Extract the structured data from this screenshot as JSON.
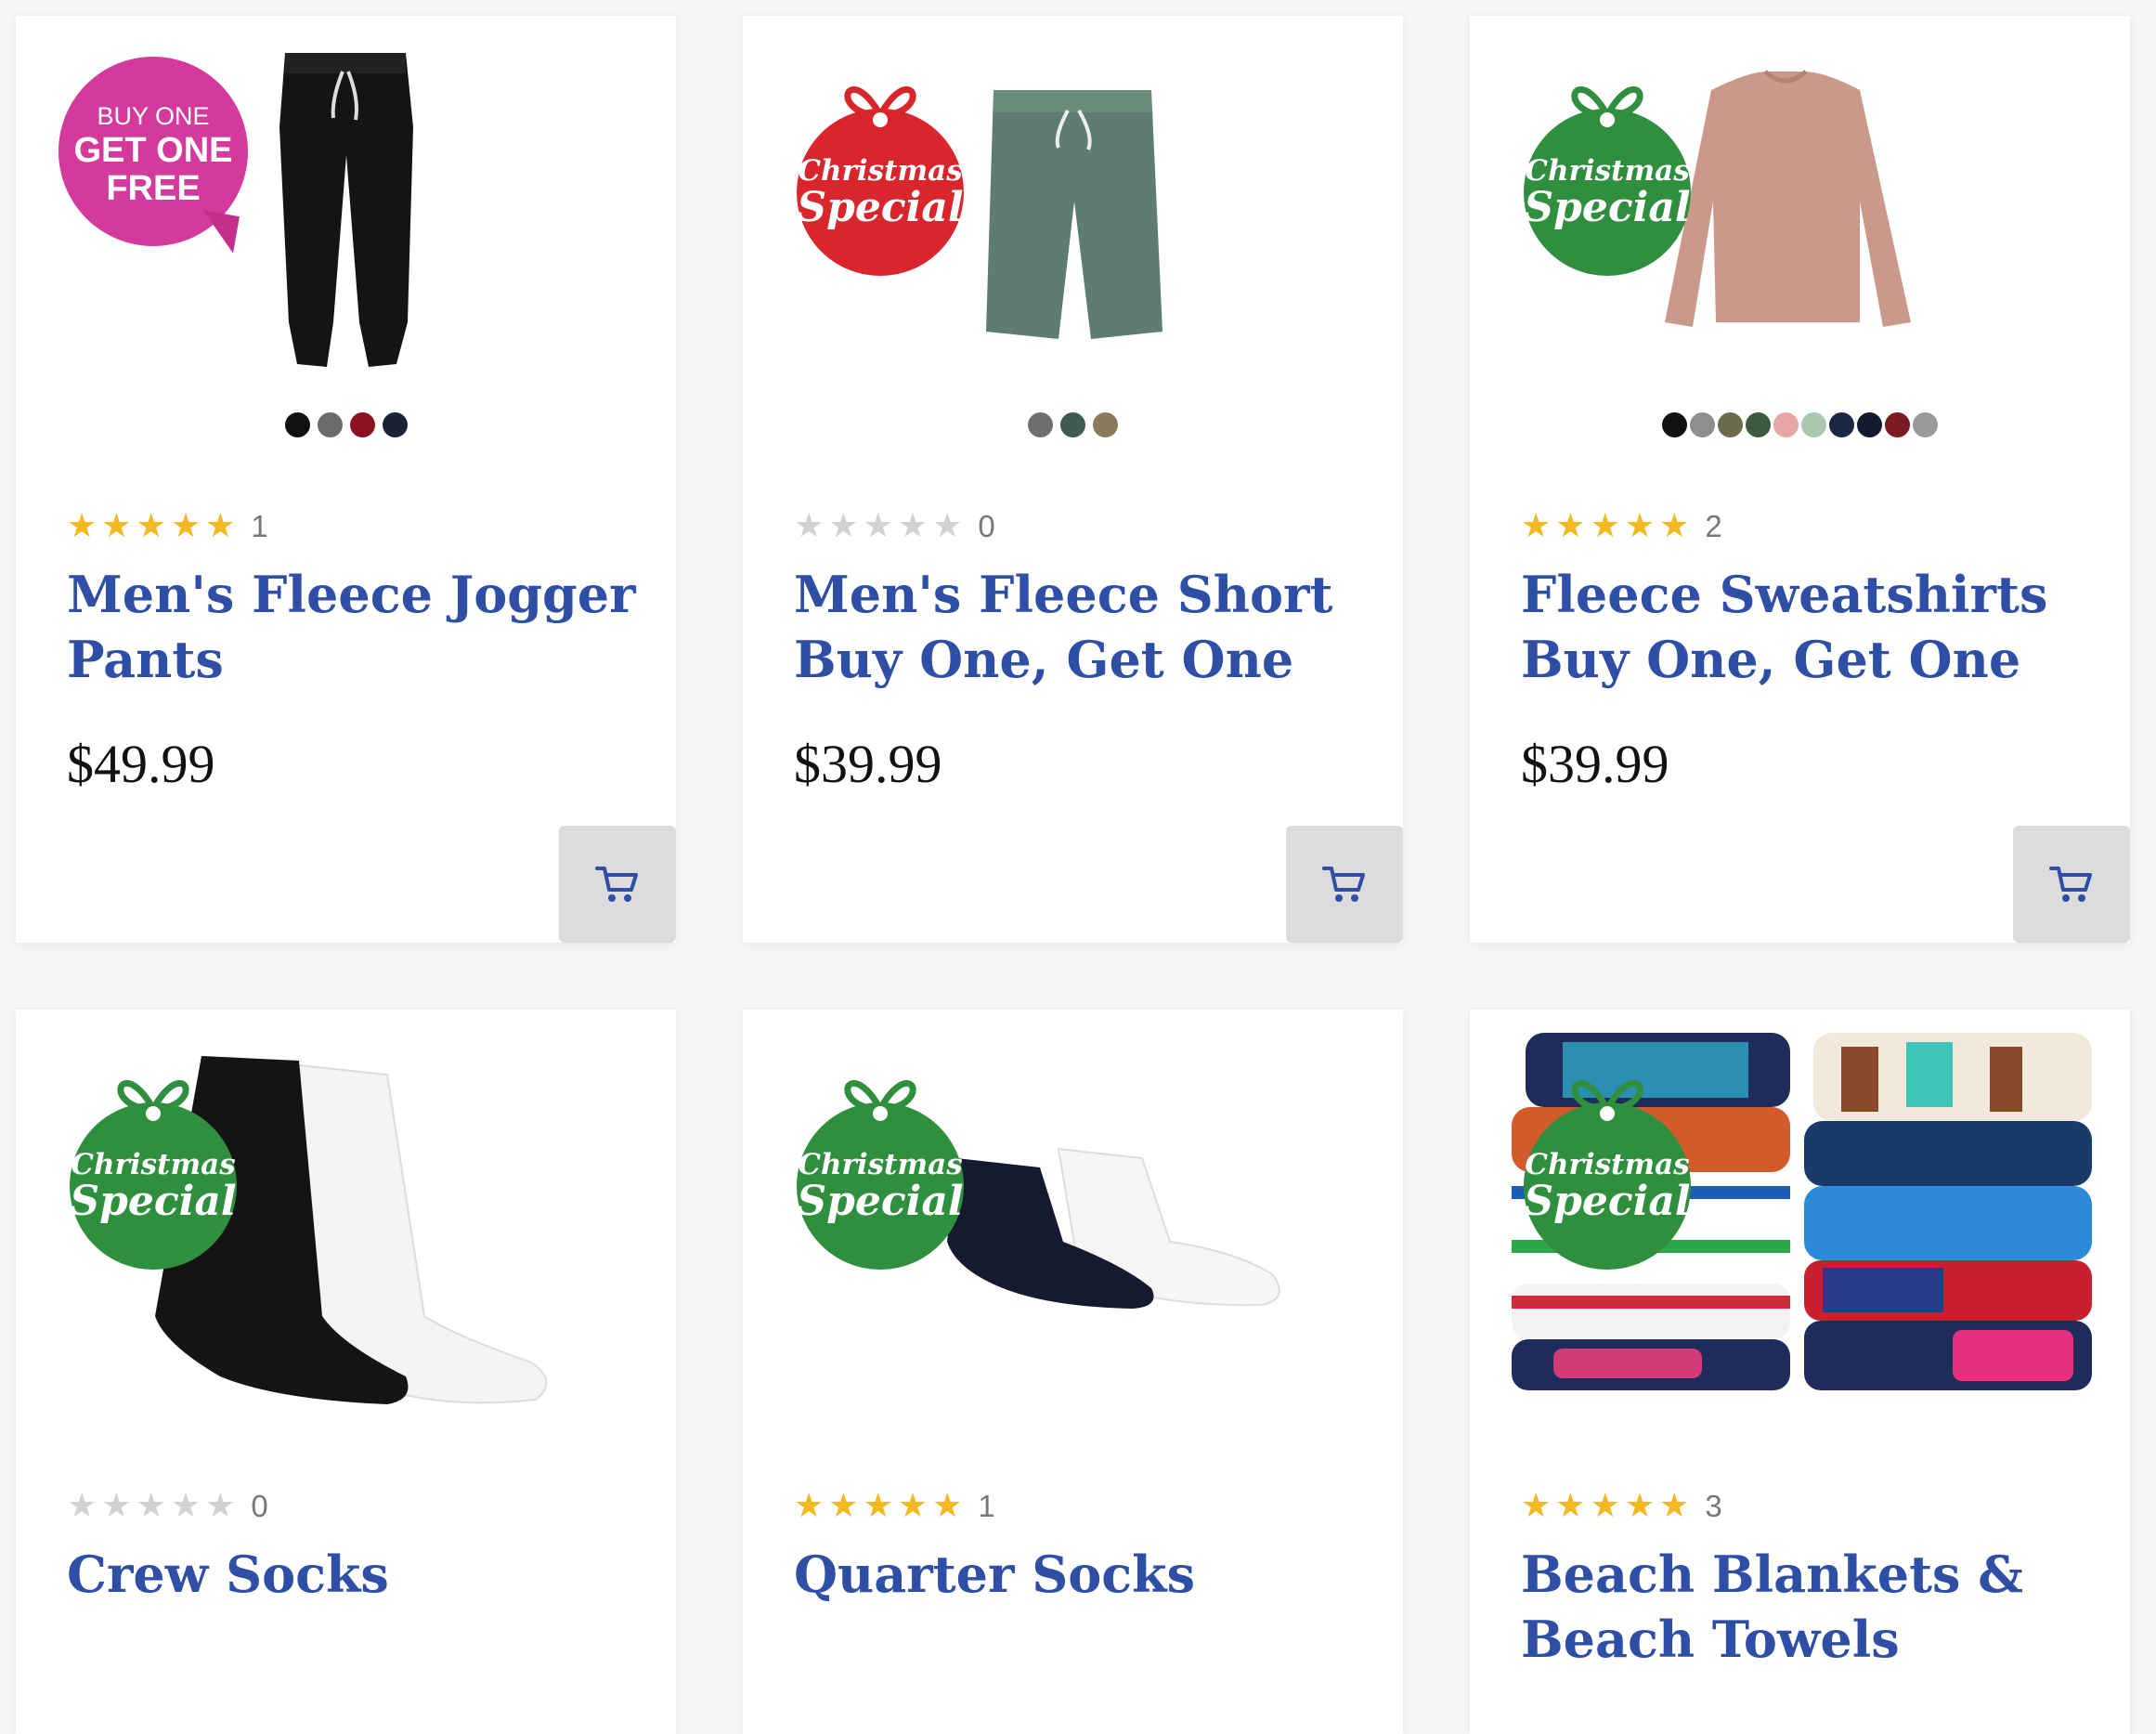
{
  "colors": {
    "title": "#2f4fa6",
    "star_on": "#f4b820",
    "star_off": "#d2d2d2",
    "badge_red": "#d8262c",
    "badge_green": "#2f8f3e",
    "badge_pink": "#d43a9b",
    "cart_button": "#dcdcdc"
  },
  "badges": {
    "xmas_line1": "Christmas",
    "xmas_line2": "Special",
    "bogo_line1": "BUY ONE",
    "bogo_line2": "GET ONE",
    "bogo_line3": "FREE"
  },
  "products": [
    {
      "title": "Men's Fleece Jogger Pants",
      "rating": 5,
      "review_count": "1",
      "price": "$49.99",
      "badge": "bogo",
      "image": "jogger-pants",
      "swatches": [
        "#111111",
        "#6b6b6b",
        "#8b1020",
        "#1b2236"
      ]
    },
    {
      "title": "Men's Fleece Short Buy One, Get One",
      "rating": 0,
      "review_count": "0",
      "price": "$39.99",
      "badge": "christmas-red",
      "image": "fleece-short",
      "swatches": [
        "#6f6f6f",
        "#3f5a52",
        "#8a7a5c"
      ]
    },
    {
      "title": "Fleece Sweatshirts Buy One, Get One",
      "rating": 5,
      "review_count": "2",
      "price": "$39.99",
      "badge": "christmas-green",
      "image": "sweatshirt",
      "swatches": [
        "#111111",
        "#8e8e8e",
        "#6a6c4a",
        "#3e5a3e",
        "#e8a5a5",
        "#a8c8b0",
        "#1d2642",
        "#131a2e",
        "#7a1a22",
        "#9a9a9a"
      ]
    },
    {
      "title": "Crew Socks",
      "rating": 0,
      "review_count": "0",
      "badge": "christmas-green",
      "image": "crew-socks"
    },
    {
      "title": "Quarter Socks",
      "rating": 5,
      "review_count": "1",
      "badge": "christmas-green",
      "image": "quarter-socks"
    },
    {
      "title": "Beach Blankets & Beach Towels",
      "rating": 5,
      "review_count": "3",
      "badge": "christmas-green",
      "image": "beach-towels"
    }
  ]
}
